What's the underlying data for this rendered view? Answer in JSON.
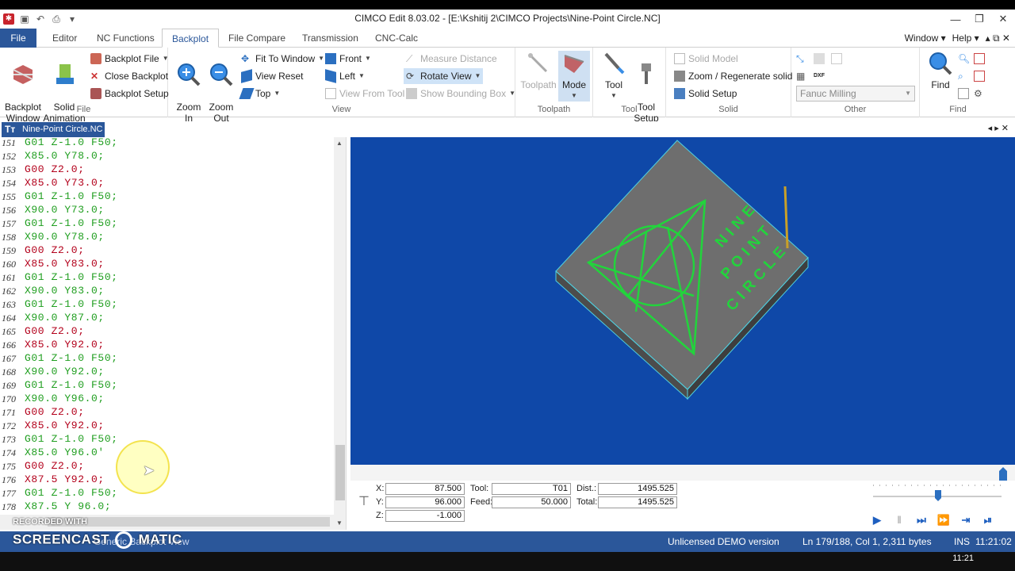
{
  "window": {
    "title": "CIMCO Edit 8.03.02 - [E:\\Kshitij 2\\CIMCO Projects\\Nine-Point Circle.NC]",
    "controls": {
      "minimize": "—",
      "restore": "❐",
      "close": "✕"
    }
  },
  "menu": {
    "tabs": [
      "File",
      "Editor",
      "NC Functions",
      "Backplot",
      "File Compare",
      "Transmission",
      "CNC-Calc"
    ],
    "active": "Backplot",
    "right": {
      "window": "Window ▾",
      "help": "Help ▾",
      "icons": "▴ ⧉ ✕"
    }
  },
  "ribbon": {
    "file_group": {
      "label": "File",
      "backplot_window": "Backplot\nWindow",
      "solid_animation": "Solid\nAnimation",
      "backplot_file": "Backplot File",
      "close_backplot": "Close Backplot",
      "backplot_setup": "Backplot Setup"
    },
    "view_group": {
      "label": "View",
      "zoom_in": "Zoom\nIn",
      "zoom_out": "Zoom\nOut",
      "fit_to_window": "Fit To Window",
      "view_reset": "View Reset",
      "top": "Top",
      "front": "Front",
      "left": "Left",
      "view_from_tool": "View From Tool",
      "measure_distance": "Measure Distance",
      "rotate_view": "Rotate View",
      "show_bounding_box": "Show Bounding Box"
    },
    "toolpath_group": {
      "label": "Toolpath",
      "toolpath": "Toolpath",
      "mode": "Mode"
    },
    "tool_group": {
      "label": "Tool",
      "tool": "Tool",
      "tool_setup": "Tool\nSetup"
    },
    "solid_group": {
      "label": "Solid",
      "solid_model": "Solid Model",
      "zoom_regenerate": "Zoom / Regenerate solid",
      "solid_setup": "Solid Setup"
    },
    "other_group": {
      "label": "Other",
      "machine": "Fanuc Milling"
    },
    "find_group": {
      "label": "Find",
      "find": "Find"
    }
  },
  "document": {
    "tab": "Nine-Point Circle.NC",
    "nav": "◂ ▸ ✕"
  },
  "code_lines": [
    {
      "n": "151",
      "t": "G01 Z-1.0 F50;",
      "c": "green"
    },
    {
      "n": "152",
      "t": "X85.0 Y78.0;",
      "c": "green"
    },
    {
      "n": "153",
      "t": "G00 Z2.0;",
      "c": "red"
    },
    {
      "n": "154",
      "t": "X85.0 Y73.0;",
      "c": "red"
    },
    {
      "n": "155",
      "t": "G01 Z-1.0 F50;",
      "c": "green"
    },
    {
      "n": "156",
      "t": "X90.0 Y73.0;",
      "c": "green"
    },
    {
      "n": "157",
      "t": "G01 Z-1.0 F50;",
      "c": "green"
    },
    {
      "n": "158",
      "t": "X90.0 Y78.0;",
      "c": "green"
    },
    {
      "n": "159",
      "t": "G00 Z2.0;",
      "c": "red"
    },
    {
      "n": "160",
      "t": "X85.0 Y83.0;",
      "c": "red"
    },
    {
      "n": "161",
      "t": "G01 Z-1.0 F50;",
      "c": "green"
    },
    {
      "n": "162",
      "t": "X90.0 Y83.0;",
      "c": "green"
    },
    {
      "n": "163",
      "t": "G01 Z-1.0 F50;",
      "c": "green"
    },
    {
      "n": "164",
      "t": "X90.0 Y87.0;",
      "c": "green"
    },
    {
      "n": "165",
      "t": "G00 Z2.0;",
      "c": "red"
    },
    {
      "n": "166",
      "t": "X85.0 Y92.0;",
      "c": "red"
    },
    {
      "n": "167",
      "t": "G01 Z-1.0 F50;",
      "c": "green"
    },
    {
      "n": "168",
      "t": "X90.0 Y92.0;",
      "c": "green"
    },
    {
      "n": "169",
      "t": "G01 Z-1.0 F50;",
      "c": "green"
    },
    {
      "n": "170",
      "t": "X90.0 Y96.0;",
      "c": "green"
    },
    {
      "n": "171",
      "t": "G00 Z2.0;",
      "c": "red"
    },
    {
      "n": "172",
      "t": "X85.0 Y92.0;",
      "c": "red"
    },
    {
      "n": "173",
      "t": "G01 Z-1.0 F50;",
      "c": "green"
    },
    {
      "n": "174",
      "t": "X85.0 Y96.0'",
      "c": "green"
    },
    {
      "n": "175",
      "t": "G00 Z2.0;",
      "c": "red"
    },
    {
      "n": "176",
      "t": "X87.5 Y92.0;",
      "c": "red"
    },
    {
      "n": "177",
      "t": "G01 Z-1.0 F50;",
      "c": "green"
    },
    {
      "n": "178",
      "t": "X87.5 Y 96.0;",
      "c": "green"
    },
    {
      "n": "179",
      "t": "",
      "c": "green"
    }
  ],
  "viewport": {
    "engraving_text": [
      "NINE",
      "POINT",
      "CIRCLE"
    ],
    "colors": {
      "background": "#0f48a8",
      "stock": "#6e6e6e",
      "toolpath": "#22d43c",
      "tool": "#c8a028"
    }
  },
  "readout": {
    "x_label": "X:",
    "x": "87.500",
    "y_label": "Y:",
    "y": "96.000",
    "z_label": "Z:",
    "z": "-1.000",
    "tool_label": "Tool:",
    "tool": "T01",
    "feed_label": "Feed:",
    "feed": "50.000",
    "dist_label": "Dist.:",
    "dist": "1495.525",
    "total_label": "Total:",
    "total": "1495.525"
  },
  "status": {
    "left": "Generic Backplot View",
    "license": "Unlicensed DEMO version",
    "position": "Ln 179/188, Col 1, 2,311 bytes",
    "mode": "INS",
    "time": "11:21:02"
  },
  "watermark": {
    "line1": "RECORDED WITH",
    "line2": "SCREENCAST",
    "line3": "MATIC"
  },
  "taskbar": {
    "clock": "11:21"
  }
}
